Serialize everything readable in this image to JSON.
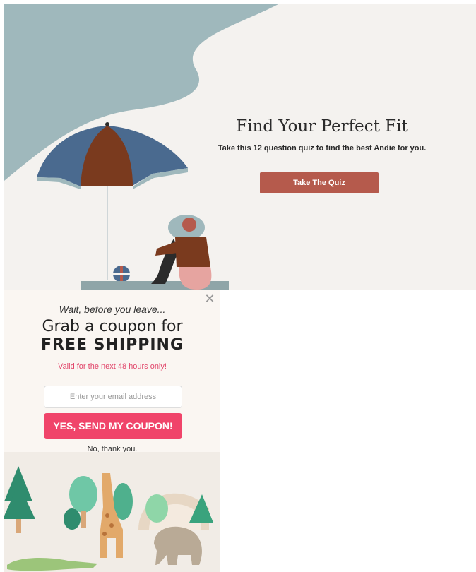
{
  "hero": {
    "title": "Find Your Perfect Fit",
    "subtitle": "Take this 12 question quiz to find the best Andie for you.",
    "cta_label": "Take The Quiz",
    "colors": {
      "cta": "#b55a4c",
      "sky": "#9fb8bc",
      "umbrella_blue": "#4a6a8f",
      "umbrella_brown": "#7a3a1e"
    }
  },
  "popup": {
    "pre_text": "Wait, before you leave...",
    "headline": "Grab a coupon for",
    "headline_strong": "FREE SHIPPING",
    "validity": "Valid for the next 48 hours only!",
    "email_placeholder": "Enter your email address",
    "email_value": "",
    "submit_label": "YES, SEND MY COUPON!",
    "decline_label": "No, thank you.",
    "close_icon": "close-icon",
    "colors": {
      "accent": "#f0446a",
      "validity": "#e1456a"
    }
  }
}
